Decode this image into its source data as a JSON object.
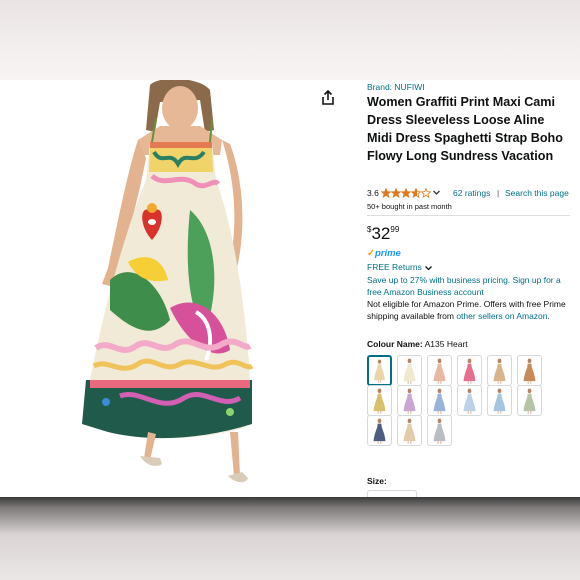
{
  "product": {
    "brand_label": "Brand: NUFIWI",
    "title": "Women Graffiti Print Maxi Cami Dress Sleeveless Loose Aline Midi Dress Spaghetti Strap Boho Flowy Long Sundress Vacation",
    "rating_value": "3.6",
    "rating_fraction": 0.72,
    "ratings_link": "62 ratings",
    "separator": "|",
    "search_link": "Search this page",
    "bought": "50+ bought in past month",
    "price_symbol": "$",
    "price_whole": "32",
    "price_fraction": "99",
    "prime_check": "✓",
    "prime_label": "prime",
    "free_returns": "FREE Returns",
    "savings_text": "Save up to 27% with business pricing. Sign up for a free Amazon Business account",
    "eligibility_text": "Not eligible for Amazon Prime. Offers with free Prime shipping available from",
    "eligibility_link": "other sellers on Amazon",
    "eligibility_end": ".",
    "colour_label": "Colour Name:",
    "colour_value": "A135 Heart",
    "size_label": "Size:"
  },
  "colors": {
    "link": "#007185",
    "price_text": "#0f1111",
    "star": "#de7921",
    "prime_blue": "#1a98ff",
    "selected_border": "#007185"
  },
  "icons": {
    "share": "share-icon",
    "chevron": "chevron-down-icon"
  },
  "swatches": [
    {
      "variant": "A135 Heart",
      "selected": true,
      "dress_color": "#e8d5a8"
    },
    {
      "variant": "cream",
      "selected": false,
      "dress_color": "#f2e7cf"
    },
    {
      "variant": "peach",
      "selected": false,
      "dress_color": "#e9b8a0"
    },
    {
      "variant": "pink",
      "selected": false,
      "dress_color": "#e76e8c"
    },
    {
      "variant": "tan",
      "selected": false,
      "dress_color": "#d9b48a"
    },
    {
      "variant": "floral",
      "selected": false,
      "dress_color": "#c98a5a"
    },
    {
      "variant": "yellow floral",
      "selected": false,
      "dress_color": "#d8c16a"
    },
    {
      "variant": "lilac",
      "selected": false,
      "dress_color": "#c9a6d4"
    },
    {
      "variant": "blue print",
      "selected": false,
      "dress_color": "#9ab3d8"
    },
    {
      "variant": "light blue",
      "selected": false,
      "dress_color": "#bcd0e6"
    },
    {
      "variant": "sky",
      "selected": false,
      "dress_color": "#a4c6e0"
    },
    {
      "variant": "sage",
      "selected": false,
      "dress_color": "#b7c4a6"
    },
    {
      "variant": "navy print",
      "selected": false,
      "dress_color": "#4d5c80"
    },
    {
      "variant": "sand",
      "selected": false,
      "dress_color": "#e2cba8"
    },
    {
      "variant": "grey",
      "selected": false,
      "dress_color": "#b9bcc2"
    }
  ]
}
